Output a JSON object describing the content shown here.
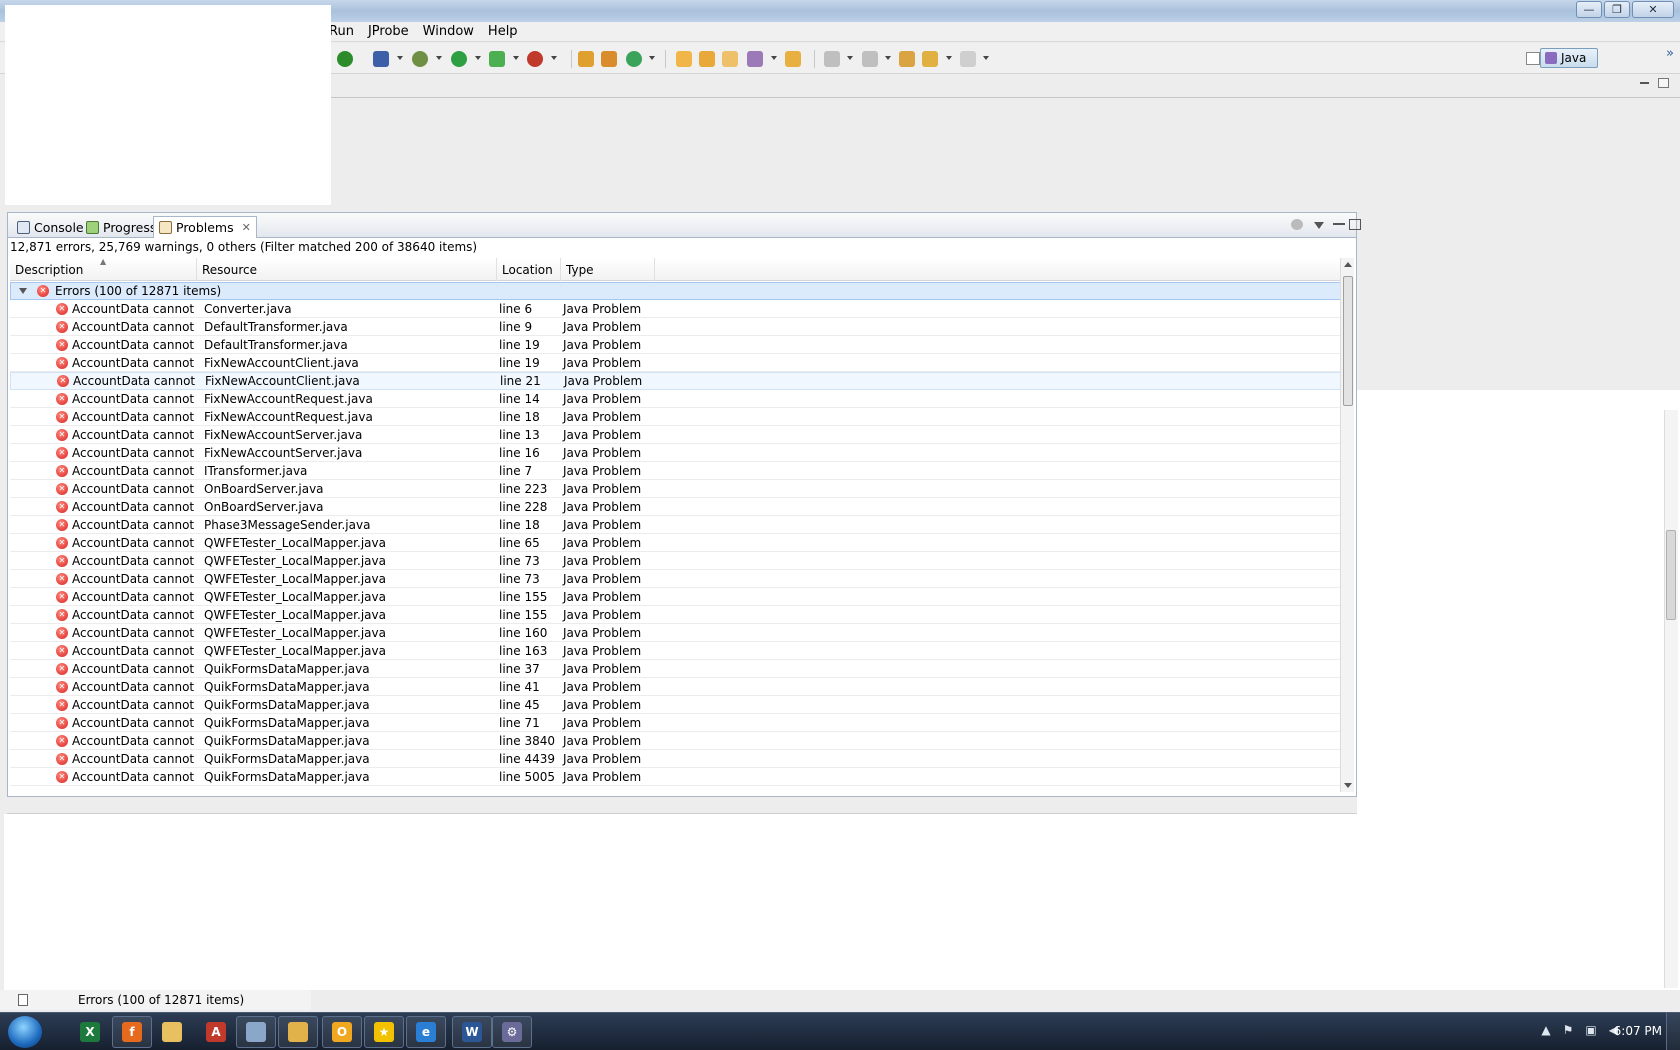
{
  "window": {
    "controls": {
      "minimize": "—",
      "maximize": "❐",
      "close": "✕"
    }
  },
  "menubar": {
    "items": [
      "Run",
      "JProbe",
      "Window",
      "Help"
    ]
  },
  "toolbar": {
    "perspective_label": "Java",
    "overflow_glyph": "»"
  },
  "view": {
    "tabs": [
      {
        "label": "Console",
        "active": false
      },
      {
        "label": "Progress",
        "active": false
      },
      {
        "label": "Problems",
        "active": true
      }
    ],
    "summary": "12,871 errors, 25,769 warnings, 0 others (Filter matched 200 of 38640 items)",
    "columns": [
      "Description",
      "Resource",
      "Location",
      "Type"
    ],
    "group_label": "Errors (100 of 12871 items)",
    "rows": [
      {
        "desc": "AccountData cannot be",
        "res": "Converter.java",
        "loc": "line 6",
        "type": "Java Problem"
      },
      {
        "desc": "AccountData cannot be",
        "res": "DefaultTransformer.java",
        "loc": "line 9",
        "type": "Java Problem"
      },
      {
        "desc": "AccountData cannot be",
        "res": "DefaultTransformer.java",
        "loc": "line 19",
        "type": "Java Problem"
      },
      {
        "desc": "AccountData cannot be",
        "res": "FixNewAccountClient.java",
        "loc": "line 19",
        "type": "Java Problem"
      },
      {
        "desc": "AccountData cannot be",
        "res": "FixNewAccountClient.java",
        "loc": "line 21",
        "type": "Java Problem"
      },
      {
        "desc": "AccountData cannot be",
        "res": "FixNewAccountRequest.java",
        "loc": "line 14",
        "type": "Java Problem"
      },
      {
        "desc": "AccountData cannot be",
        "res": "FixNewAccountRequest.java",
        "loc": "line 18",
        "type": "Java Problem"
      },
      {
        "desc": "AccountData cannot be",
        "res": "FixNewAccountServer.java",
        "loc": "line 13",
        "type": "Java Problem"
      },
      {
        "desc": "AccountData cannot be",
        "res": "FixNewAccountServer.java",
        "loc": "line 16",
        "type": "Java Problem"
      },
      {
        "desc": "AccountData cannot be",
        "res": "ITransformer.java",
        "loc": "line 7",
        "type": "Java Problem"
      },
      {
        "desc": "AccountData cannot be",
        "res": "OnBoardServer.java",
        "loc": "line 223",
        "type": "Java Problem"
      },
      {
        "desc": "AccountData cannot be",
        "res": "OnBoardServer.java",
        "loc": "line 228",
        "type": "Java Problem"
      },
      {
        "desc": "AccountData cannot be",
        "res": "Phase3MessageSender.java",
        "loc": "line 18",
        "type": "Java Problem"
      },
      {
        "desc": "AccountData cannot be",
        "res": "QWFETester_LocalMapper.java",
        "loc": "line 65",
        "type": "Java Problem"
      },
      {
        "desc": "AccountData cannot be",
        "res": "QWFETester_LocalMapper.java",
        "loc": "line 73",
        "type": "Java Problem"
      },
      {
        "desc": "AccountData cannot be",
        "res": "QWFETester_LocalMapper.java",
        "loc": "line 73",
        "type": "Java Problem"
      },
      {
        "desc": "AccountData cannot be",
        "res": "QWFETester_LocalMapper.java",
        "loc": "line 155",
        "type": "Java Problem"
      },
      {
        "desc": "AccountData cannot be",
        "res": "QWFETester_LocalMapper.java",
        "loc": "line 155",
        "type": "Java Problem"
      },
      {
        "desc": "AccountData cannot be",
        "res": "QWFETester_LocalMapper.java",
        "loc": "line 160",
        "type": "Java Problem"
      },
      {
        "desc": "AccountData cannot be",
        "res": "QWFETester_LocalMapper.java",
        "loc": "line 163",
        "type": "Java Problem"
      },
      {
        "desc": "AccountData cannot be",
        "res": "QuikFormsDataMapper.java",
        "loc": "line 37",
        "type": "Java Problem"
      },
      {
        "desc": "AccountData cannot be",
        "res": "QuikFormsDataMapper.java",
        "loc": "line 41",
        "type": "Java Problem"
      },
      {
        "desc": "AccountData cannot be",
        "res": "QuikFormsDataMapper.java",
        "loc": "line 45",
        "type": "Java Problem"
      },
      {
        "desc": "AccountData cannot be",
        "res": "QuikFormsDataMapper.java",
        "loc": "line 71",
        "type": "Java Problem"
      },
      {
        "desc": "AccountData cannot be",
        "res": "QuikFormsDataMapper.java",
        "loc": "line 3840",
        "type": "Java Problem"
      },
      {
        "desc": "AccountData cannot be",
        "res": "QuikFormsDataMapper.java",
        "loc": "line 4439",
        "type": "Java Problem"
      },
      {
        "desc": "AccountData cannot be",
        "res": "QuikFormsDataMapper.java",
        "loc": "line 5005",
        "type": "Java Problem"
      }
    ]
  },
  "statusbar": {
    "text": "Errors (100 of 12871 items)"
  },
  "taskbar": {
    "apps": [
      "excel",
      "firefox",
      "folder-open",
      "pdf",
      "notepad",
      "explorer",
      "outlook",
      "runner",
      "internet-explorer",
      "word",
      "eclipse"
    ],
    "clock": "6:07 PM"
  },
  "colors": {
    "selection": "#dcebfc",
    "error": "#d8231d",
    "taskbar": "#1e2a3c"
  }
}
